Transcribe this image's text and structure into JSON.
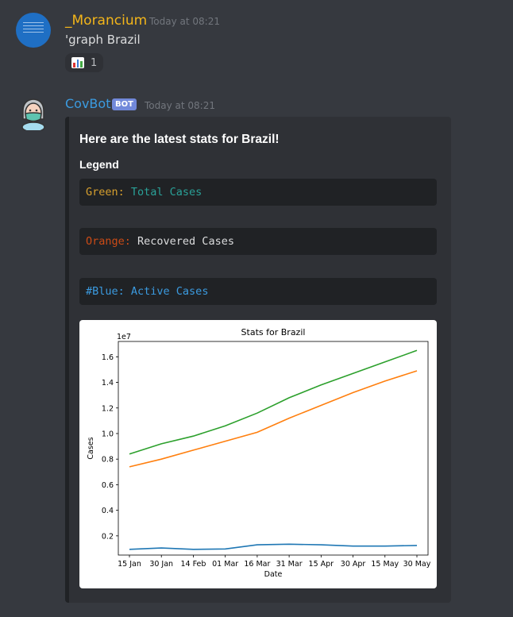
{
  "message1": {
    "username": "_Morancium",
    "timestamp": "Today at 08:21",
    "content": "'graph Brazil",
    "reaction": {
      "icon": "bar-chart-emoji",
      "count": "1"
    }
  },
  "message2": {
    "username": "CovBot",
    "bot_tag": "BOT",
    "timestamp": "Today at 08:21",
    "embed": {
      "title": "Here are the latest stats for Brazil!",
      "legend_heading": "Legend",
      "code1": {
        "key": "Green:",
        "value": " Total Cases"
      },
      "code2": {
        "key": "Orange:",
        "value": " Recovered Cases"
      },
      "code3": {
        "key": "#Blue:",
        "value": " Active Cases"
      }
    }
  },
  "colors": {
    "username1": "#f3b51a",
    "username2": "#3b9be0",
    "total": "#2ca02c",
    "recovered": "#ff7f0e",
    "active": "#1f77b4"
  },
  "chart_data": {
    "type": "line",
    "title": "Stats for Brazil",
    "xlabel": "Date",
    "ylabel": "Cases",
    "y_multiplier_label": "1e7",
    "x": [
      "15 Jan",
      "30 Jan",
      "14 Feb",
      "01 Mar",
      "16 Mar",
      "31 Mar",
      "15 Apr",
      "30 Apr",
      "15 May",
      "30 May"
    ],
    "yticks": [
      0.2,
      0.4,
      0.6,
      0.8,
      1.0,
      1.2,
      1.4,
      1.6
    ],
    "ylim": [
      0.05,
      1.72
    ],
    "series": [
      {
        "color": "#2ca02c",
        "values": [
          0.84,
          0.92,
          0.98,
          1.06,
          1.16,
          1.28,
          1.38,
          1.47,
          1.56,
          1.65
        ]
      },
      {
        "color": "#ff7f0e",
        "values": [
          0.74,
          0.8,
          0.87,
          0.94,
          1.01,
          1.12,
          1.22,
          1.32,
          1.41,
          1.49
        ]
      },
      {
        "color": "#1f77b4",
        "values": [
          0.095,
          0.105,
          0.095,
          0.098,
          0.13,
          0.135,
          0.13,
          0.12,
          0.12,
          0.125
        ]
      }
    ]
  }
}
